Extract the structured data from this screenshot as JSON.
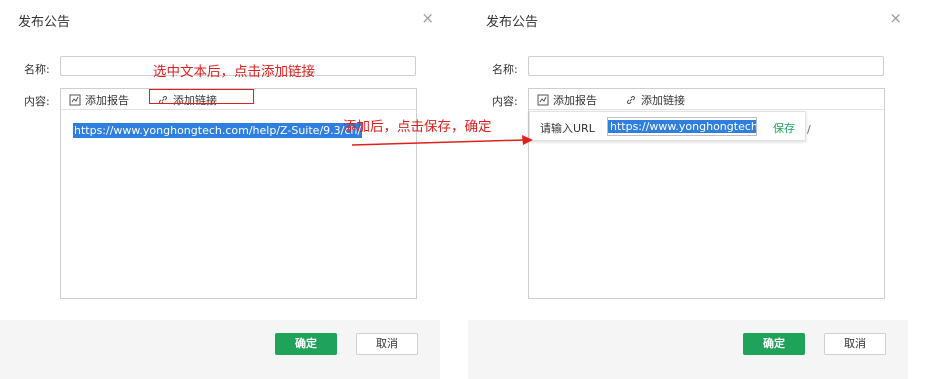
{
  "left_dialog": {
    "title": "发布公告",
    "close_symbol": "×",
    "name_label": "名称:",
    "content_label": "内容:",
    "toolbar": {
      "add_report": "添加报告",
      "add_link": "添加链接"
    },
    "selected_text": "https://www.yonghongtech.com/help/Z-Suite/9.3/ch/",
    "ok_label": "确定",
    "cancel_label": "取消"
  },
  "right_dialog": {
    "title": "发布公告",
    "close_symbol": "×",
    "name_label": "名称:",
    "content_label": "内容:",
    "toolbar": {
      "add_report": "添加报告",
      "add_link": "添加链接"
    },
    "url_popup": {
      "label": "请输入URL",
      "value": "https://www.yonghongtech.c",
      "save_label": "保存"
    },
    "stray_char": "/",
    "ok_label": "确定",
    "cancel_label": "取消"
  },
  "annotations": {
    "step1": "选中文本后，点击添加链接",
    "step2": "添加后，点击保存，确定"
  },
  "colors": {
    "accent_green": "#1fa25a",
    "selection_blue": "#2f7fe0",
    "annotation_red": "#e0201e"
  }
}
